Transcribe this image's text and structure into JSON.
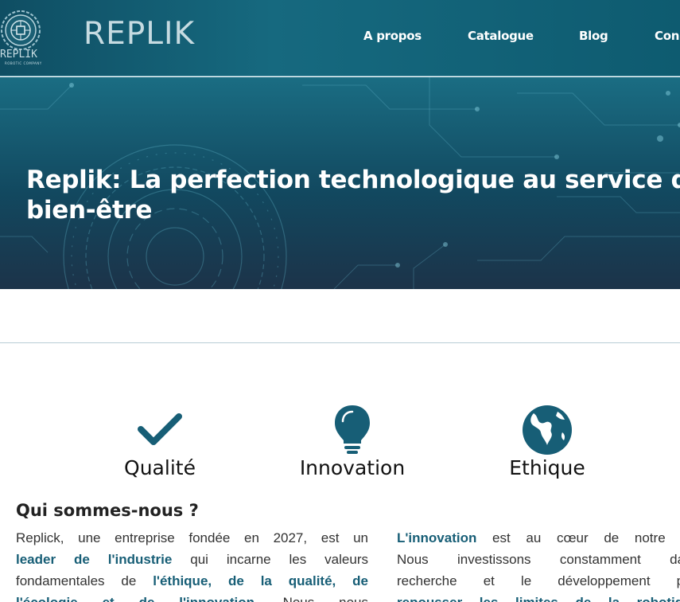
{
  "header": {
    "logo_text": "REPLIK",
    "logo_subtext": "ROBOTIC COMPANY",
    "brand": "REPLIK",
    "nav": [
      {
        "label": "A propos"
      },
      {
        "label": "Catalogue"
      },
      {
        "label": "Blog"
      },
      {
        "label": "Con"
      }
    ]
  },
  "hero": {
    "title_line1": "Replik: La perfection technologique au service de",
    "title_line2": "bien-être"
  },
  "values": [
    {
      "label": "Qualité",
      "icon": "checkmark-icon"
    },
    {
      "label": "Innovation",
      "icon": "lightbulb-icon"
    },
    {
      "label": "Ethique",
      "icon": "globe-icon"
    }
  ],
  "about": {
    "title": "Qui sommes-nous ?",
    "left": {
      "l1": "Replick, une entreprise fondée en 2027, est un",
      "l2_hl": "leader de l'industrie",
      "l2_rest": " qui incarne les valeurs",
      "l3_pre": "fondamentales de ",
      "l3_hl": "l'éthique, de la qualité, de",
      "l4_hl": "l'écologie et de l'innovation",
      "l4_rest": ". Nous nous"
    },
    "right": {
      "l1_hl": "L'innovation",
      "l1_rest": " est au cœur de notre AD",
      "l2": "Nous investissons constamment dans",
      "l3": "recherche et le développement pou",
      "l4_hl": "repousser les limites de la robotique"
    }
  },
  "colors": {
    "header": "#16697f",
    "accent": "#175e76",
    "hero_dark": "#12485f"
  }
}
